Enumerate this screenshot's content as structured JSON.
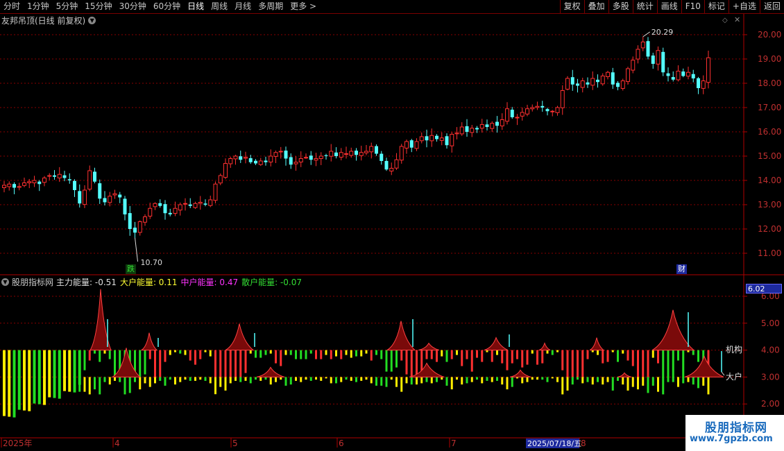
{
  "toolbar": {
    "periods": [
      "分时",
      "1分钟",
      "5分钟",
      "15分钟",
      "30分钟",
      "60分钟",
      "日线",
      "周线",
      "月线",
      "多周期",
      "更多 >"
    ],
    "active_period": "日线",
    "actions": [
      "复权",
      "叠加",
      "多股",
      "统计",
      "画线",
      "F10",
      "标记",
      "+自选",
      "返回"
    ]
  },
  "main_chart": {
    "title": "友邦吊顶(日线 前复权)",
    "price_axis": [
      "20.00",
      "19.00",
      "18.00",
      "17.00",
      "16.00",
      "15.00",
      "14.00",
      "13.00",
      "12.00",
      "11.00"
    ],
    "high_label": "20.29",
    "low_label": "10.70",
    "badge_fall": "跌",
    "badge_finance": "财"
  },
  "indicator": {
    "name": "股朋指标网",
    "items": [
      {
        "label": "主力能量:",
        "value": "-0.51",
        "color": "#e0e0e0"
      },
      {
        "label": "大户能量:",
        "value": "0.11",
        "color": "#ffff33"
      },
      {
        "label": "中户能量:",
        "value": "0.47",
        "color": "#ff33ff"
      },
      {
        "label": "散户能量:",
        "value": "-0.07",
        "color": "#33dd33"
      }
    ],
    "axis": [
      "6.00",
      "5.00",
      "4.00",
      "3.00",
      "2.00"
    ],
    "current_value": "6.02",
    "line_labels": [
      "机构",
      "大户"
    ]
  },
  "date_axis": {
    "labels": [
      "2025年",
      "4",
      "5",
      "6",
      "7",
      "8"
    ],
    "cursor_date": "2025/07/18/五"
  },
  "watermark": {
    "name": "股朋指标网",
    "url": "www.7gpzb.com"
  },
  "colors": {
    "up": "#ff3030",
    "down": "#54ffff",
    "grid": "#8a0000",
    "mass": "#7a0a0a"
  },
  "chart_data": {
    "type": "candlestick",
    "ylim": [
      10.5,
      20.5
    ],
    "closes": [
      13.8,
      13.85,
      13.7,
      13.75,
      13.9,
      13.95,
      14.0,
      13.85,
      14.1,
      14.2,
      14.15,
      14.25,
      14.1,
      14.0,
      13.6,
      13.05,
      13.6,
      14.4,
      13.95,
      13.25,
      13.1,
      13.35,
      13.45,
      13.3,
      12.6,
      12.0,
      11.85,
      12.3,
      12.5,
      12.85,
      13.05,
      12.95,
      12.65,
      12.6,
      12.85,
      13.0,
      13.05,
      12.95,
      13.05,
      13.1,
      13.0,
      13.2,
      13.85,
      14.2,
      14.7,
      14.9,
      15.0,
      14.85,
      14.95,
      14.75,
      14.7,
      14.8,
      14.75,
      15.0,
      15.15,
      15.2,
      14.9,
      14.65,
      14.75,
      14.9,
      14.95,
      14.85,
      14.9,
      15.0,
      15.0,
      15.2,
      15.0,
      15.15,
      15.1,
      15.2,
      15.05,
      15.15,
      15.2,
      15.4,
      15.1,
      14.8,
      14.45,
      14.5,
      14.85,
      15.4,
      15.6,
      15.35,
      15.6,
      15.8,
      15.65,
      15.85,
      15.7,
      15.75,
      15.45,
      15.9,
      15.95,
      16.2,
      16.0,
      16.15,
      16.1,
      16.3,
      16.2,
      16.35,
      16.25,
      16.5,
      16.95,
      16.6,
      16.6,
      16.8,
      16.95,
      17.0,
      17.05,
      17.0,
      16.85,
      16.85,
      17.0,
      17.7,
      18.2,
      17.95,
      17.9,
      18.1,
      17.95,
      18.2,
      18.05,
      18.3,
      18.45,
      17.95,
      17.85,
      18.1,
      18.6,
      18.95,
      19.4,
      19.7,
      19.1,
      18.8,
      19.35,
      18.45,
      18.3,
      18.15,
      18.5,
      18.3,
      18.45,
      18.2,
      17.8,
      18.1,
      19.05
    ]
  }
}
